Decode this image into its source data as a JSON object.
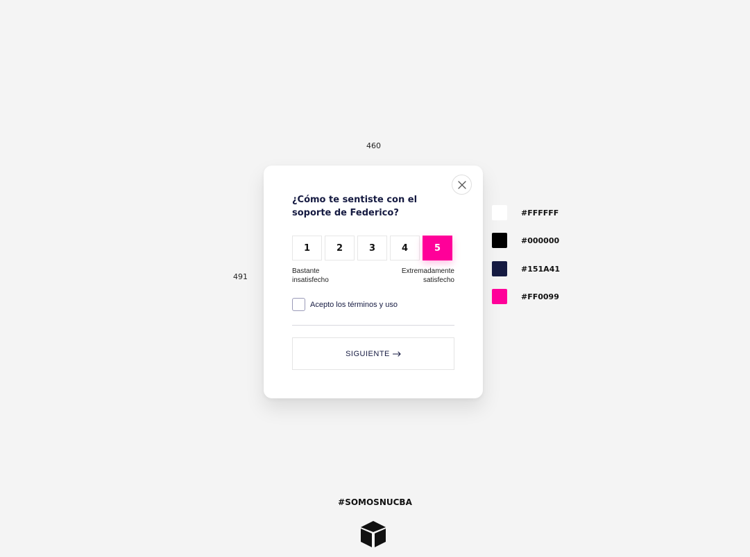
{
  "annotations": {
    "width_label": "460",
    "height_label": "491"
  },
  "modal": {
    "question": "¿Cómo te sentiste con el soporte de Federico?",
    "scale": {
      "options": [
        "1",
        "2",
        "3",
        "4",
        "5"
      ],
      "selected": "5",
      "min_label": "Bastante insatisfecho",
      "max_label": "Extremadamente satisfecho"
    },
    "terms_label": "Acepto los términos y uso",
    "terms_checked": false,
    "next_button_label": "SIGUIENTE",
    "close_icon": "close-icon",
    "next_icon": "arrow-right-icon"
  },
  "palette": [
    {
      "label": "#FFFFFF",
      "color": "#FFFFFF"
    },
    {
      "label": "#000000",
      "color": "#000000"
    },
    {
      "label": "#151A41",
      "color": "#151A41"
    },
    {
      "label": "#FF0099",
      "color": "#FF0099"
    }
  ],
  "footer": {
    "hashtag": "#SOMOSNUCBA",
    "logo_icon": "nucba-cube-logo"
  },
  "colors": {
    "accent": "#FF0099",
    "text": "#151A41",
    "background": "#F4F4F4"
  }
}
